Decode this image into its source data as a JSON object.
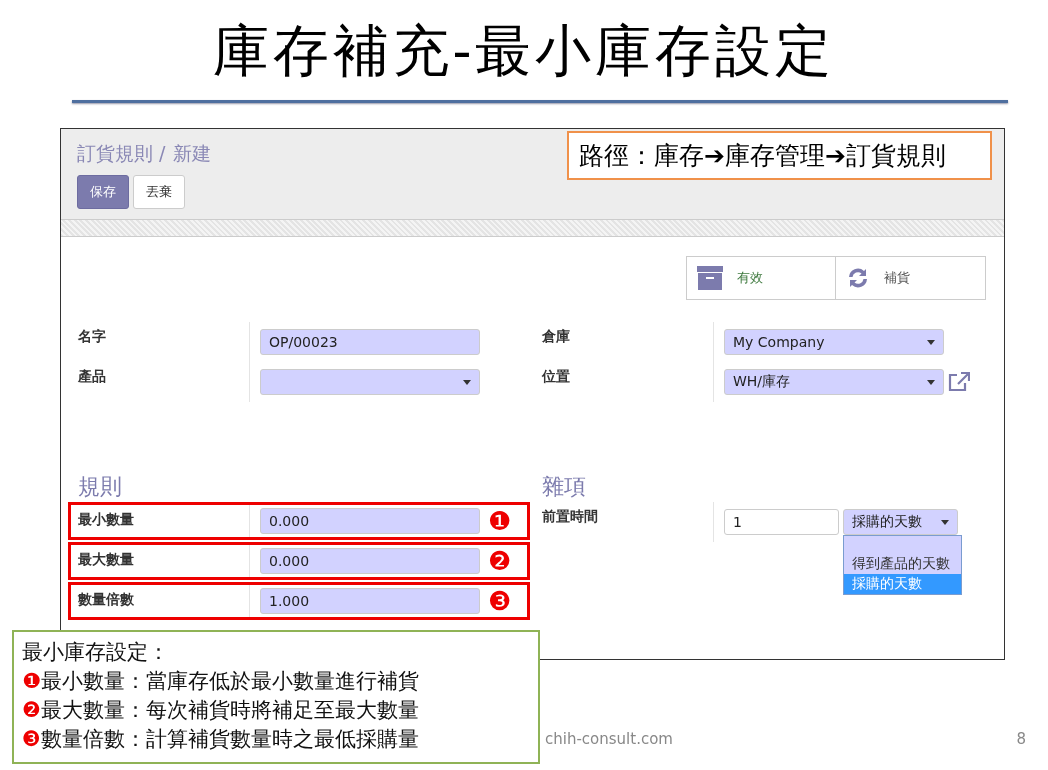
{
  "slide_title": "庫存補充-最小庫存設定",
  "breadcrumb": {
    "parent": "訂貨規則 /",
    "current": "新建"
  },
  "buttons": [
    {
      "label": "保存",
      "kind": "primary"
    },
    {
      "label": "丟棄",
      "kind": "secondary"
    }
  ],
  "path_note": "路徑：庫存➔庫存管理➔訂貨規則",
  "smart_buttons": [
    {
      "label": "有效",
      "kind": "archive"
    },
    {
      "label": "補貨",
      "kind": "refresh"
    }
  ],
  "fields_left": [
    {
      "label": "名字",
      "kind": "text",
      "value": "OP/00023"
    },
    {
      "label": "產品",
      "kind": "select"
    }
  ],
  "fields_right": [
    {
      "label": "倉庫",
      "kind": "select",
      "value": "My Company"
    },
    {
      "label": "位置",
      "kind": "select_link",
      "value": "WH/庫存"
    }
  ],
  "rules": {
    "title": "規則",
    "rows": [
      {
        "label": "最小數量",
        "value": "0.000",
        "marker": "❶"
      },
      {
        "label": "最大數量",
        "value": "0.000",
        "marker": "❷"
      },
      {
        "label": "數量倍數",
        "value": "1.000",
        "marker": "❸"
      }
    ]
  },
  "misc": {
    "title": "雜項",
    "lead_time": {
      "label": "前置時間",
      "value": "1",
      "unit": "採購的天數",
      "options": [
        {
          "label": "得到產品的天數",
          "selected": false
        },
        {
          "label": "採購的天數",
          "selected": true
        }
      ]
    }
  },
  "callout": {
    "title": "最小庫存設定：",
    "items": [
      {
        "marker": "❶",
        "text": "最小數量：當庫存低於最小數量進行補貨"
      },
      {
        "marker": "❷",
        "text": "最大數量：每次補貨時將補足至最大數量"
      },
      {
        "marker": "❸",
        "text": "數量倍數：計算補貨數量時之最低採購量"
      }
    ]
  },
  "footer": {
    "site": "chih-consult.com",
    "page": "8"
  }
}
